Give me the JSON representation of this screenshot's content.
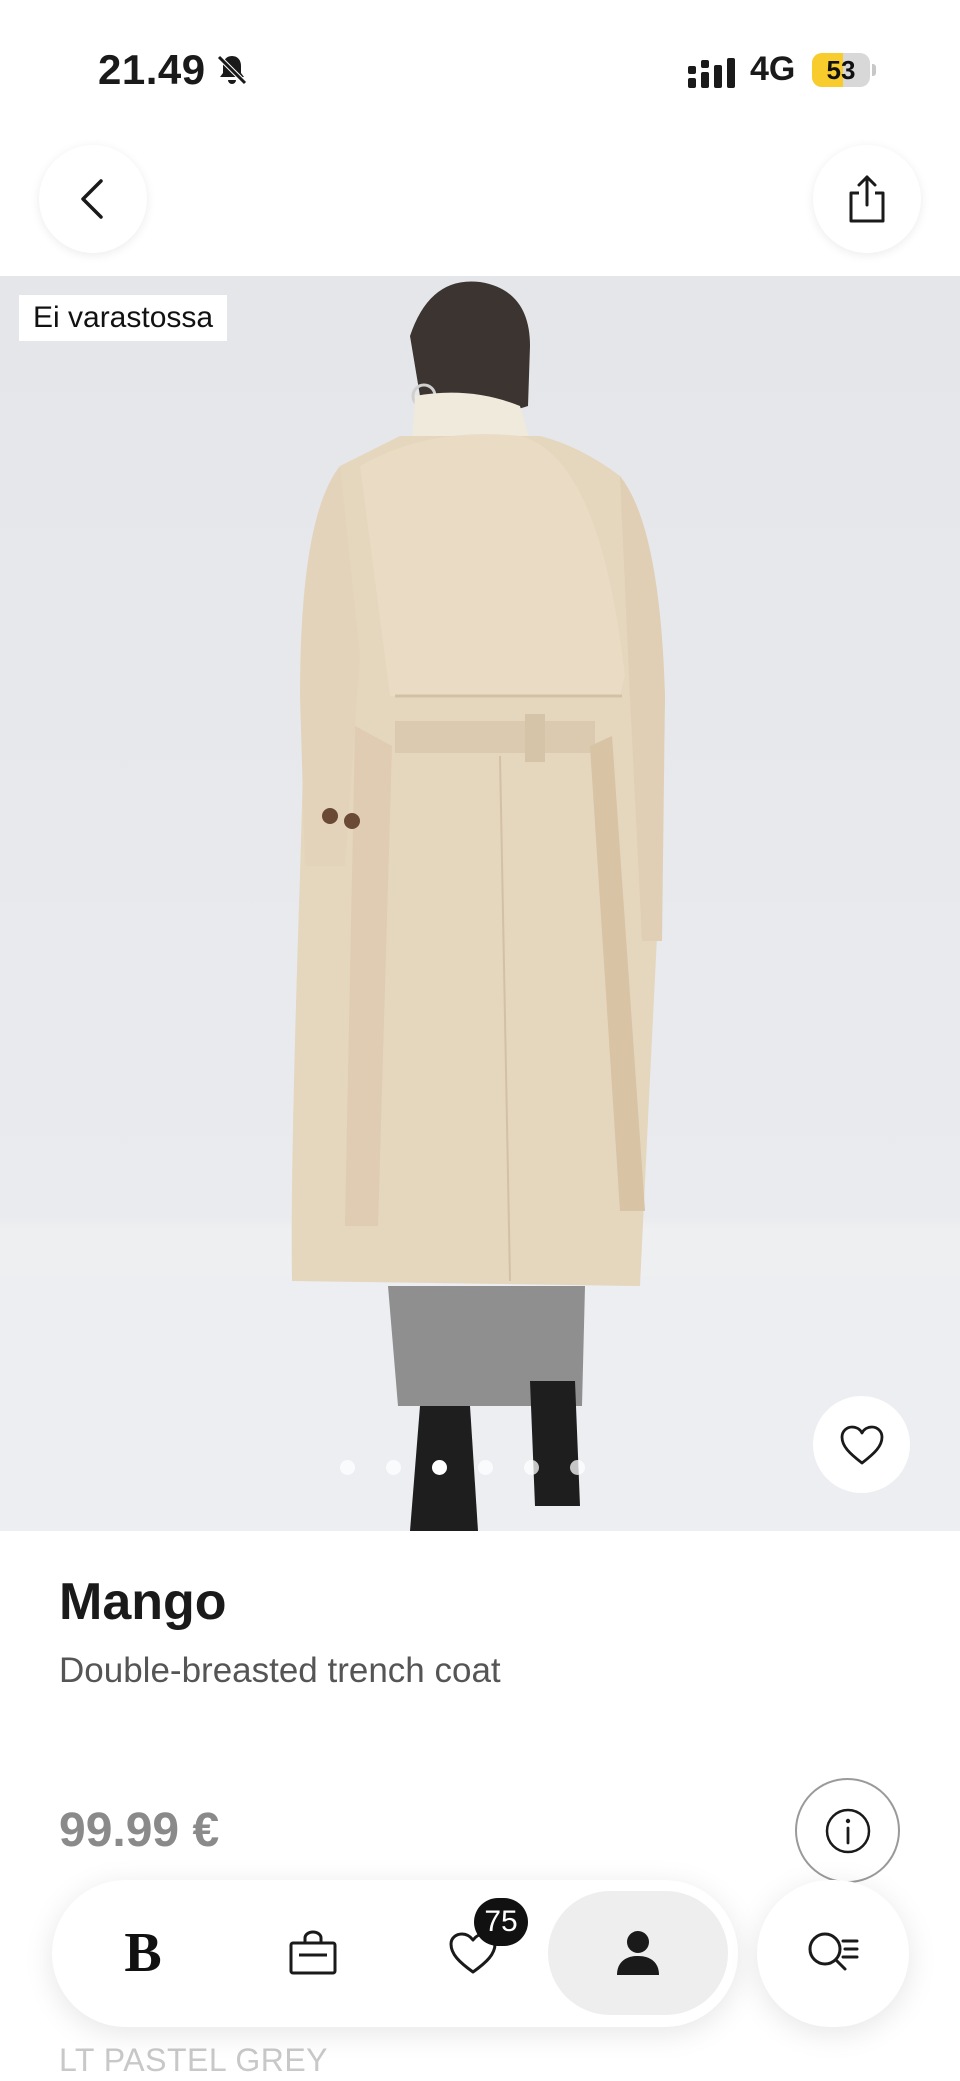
{
  "status_bar": {
    "time": "21.49",
    "network": "4G",
    "battery_level": "53",
    "battery_fraction": 0.53,
    "battery_color": "#f7cc2c"
  },
  "header": {
    "back_icon": "chevron-left-icon",
    "share_icon": "share-icon"
  },
  "product_image": {
    "stock_status": "Ei varastossa",
    "image_count": 6,
    "active_index": 2,
    "favorite_icon": "heart-outline-icon"
  },
  "product": {
    "brand": "Mango",
    "name": "Double-breasted trench coat",
    "price": "99.99 €",
    "color": "LT PASTEL GREY",
    "info_icon": "info-icon"
  },
  "bottom_nav": {
    "home_logo": "B",
    "bag_icon": "shopping-bag-icon",
    "favorites_icon": "heart-icon",
    "favorites_count": "75",
    "profile_icon": "user-icon",
    "search_icon": "search-list-icon",
    "active_tab": "profile"
  }
}
